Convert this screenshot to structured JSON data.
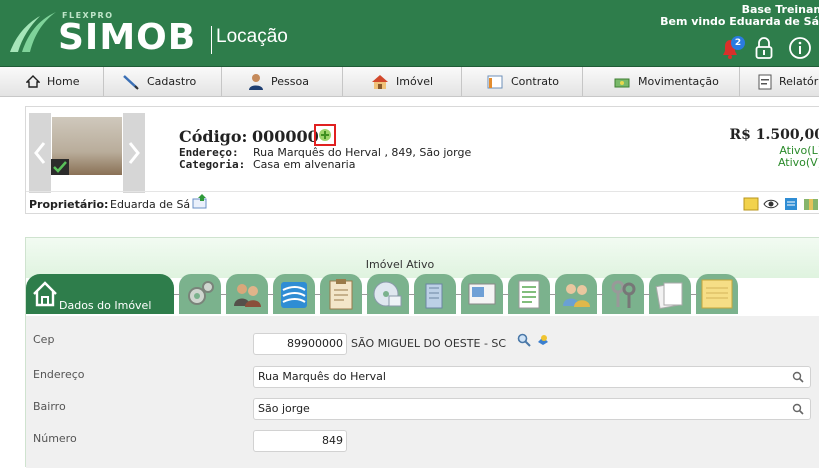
{
  "header": {
    "brand_small": "FLEXPRO",
    "brand": "SIMOB",
    "module": "Locação",
    "base_text": "Base Treinamento",
    "welcome_text": "Bem vindo Eduarda de Sá",
    "notification_count": "2"
  },
  "menu": [
    {
      "label": "Home",
      "icon": "home-icon"
    },
    {
      "label": "Cadastro",
      "icon": "pencil-icon"
    },
    {
      "label": "Pessoa",
      "icon": "person-icon"
    },
    {
      "label": "Imóvel",
      "icon": "house-icon"
    },
    {
      "label": "Contrato",
      "icon": "contract-icon"
    },
    {
      "label": "Movimentação",
      "icon": "money-icon"
    },
    {
      "label": "Relatórios",
      "icon": "report-icon"
    }
  ],
  "property": {
    "codigo_label": "Código:",
    "codigo": "000000",
    "endereco_label": "Endereço:",
    "endereco": "Rua Marquês do Herval , 849, São jorge",
    "categoria_label": "Categoria:",
    "categoria": "Casa em alvenaria",
    "price": "R$ 1.500,00",
    "status_l": "Ativo(L)",
    "status_v": "Ativo(V)",
    "owner_label": "Proprietário:",
    "owner": "Eduarda de Sá"
  },
  "panel": {
    "title": "Imóvel Ativo",
    "active_tab": "Dados do Imóvel",
    "tabs": [
      "settings-tab",
      "people-tab",
      "document-tab",
      "checklist-tab",
      "media-tab",
      "building-tab",
      "photo-tab",
      "list-tab",
      "users-tab",
      "keys-tab",
      "pages-tab",
      "note-tab"
    ]
  },
  "form": {
    "cep_label": "Cep",
    "cep": "89900000",
    "cep_city": "SÃO MIGUEL DO OESTE - SC",
    "endereco_label": "Endereço",
    "endereco": "Rua Marquês do Herval",
    "bairro_label": "Bairro",
    "bairro": "São jorge",
    "numero_label": "Número",
    "numero": "849"
  },
  "colors": {
    "brand_green": "#2e7d4b",
    "tab_inactive": "#7bb28d",
    "status_green": "#2a8a2a",
    "highlight_red": "#e02020"
  }
}
